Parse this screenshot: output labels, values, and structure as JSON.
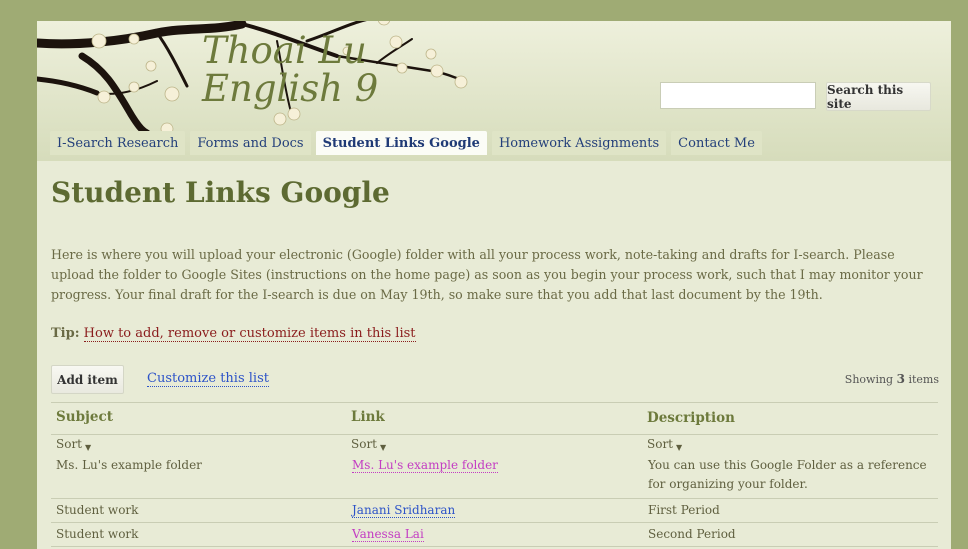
{
  "site": {
    "title_line1": "Thoai Lu",
    "title_line2": "English 9"
  },
  "search": {
    "value": "",
    "button_label": "Search this site"
  },
  "nav": {
    "tabs": [
      {
        "label": "I-Search Research",
        "active": false
      },
      {
        "label": "Forms and Docs",
        "active": false
      },
      {
        "label": "Student Links Google",
        "active": true
      },
      {
        "label": "Homework Assignments",
        "active": false
      },
      {
        "label": "Contact Me",
        "active": false
      }
    ]
  },
  "page": {
    "title": "Student Links Google",
    "intro": "Here is where you will upload your electronic (Google) folder with all your process work, note-taking and drafts for I-search.  Please upload the folder to Google Sites (instructions on the home page) as soon as you begin your process work, such that I may monitor your progress.  Your final draft for the I-search is due on May 19th, so make sure that you add that last document by the 19th.",
    "tip_label": "Tip:",
    "tip_link": "How to add, remove or customize items in this list"
  },
  "list": {
    "add_label": "Add item",
    "customize_label": "Customize this list",
    "showing_prefix": "Showing",
    "showing_count": "3",
    "showing_suffix": "items",
    "columns": [
      "Subject",
      "Link",
      "Description"
    ],
    "sort_label": "Sort",
    "sort_icon": "▼",
    "rows": [
      {
        "subject": "Ms. Lu's example folder",
        "link": "Ms. Lu's example folder",
        "description": "You can use this Google Folder as a reference for organizing your folder."
      },
      {
        "subject": "Student work",
        "link": "Janani Sridharan",
        "description": "First Period"
      },
      {
        "subject": "Student work",
        "link": "Vanessa Lai",
        "description": "Second Period"
      }
    ]
  },
  "colors": {
    "background": "#9fab74",
    "title": "#5d6a32",
    "link": "#2d53c8",
    "visited_link": "#c33cc3"
  }
}
